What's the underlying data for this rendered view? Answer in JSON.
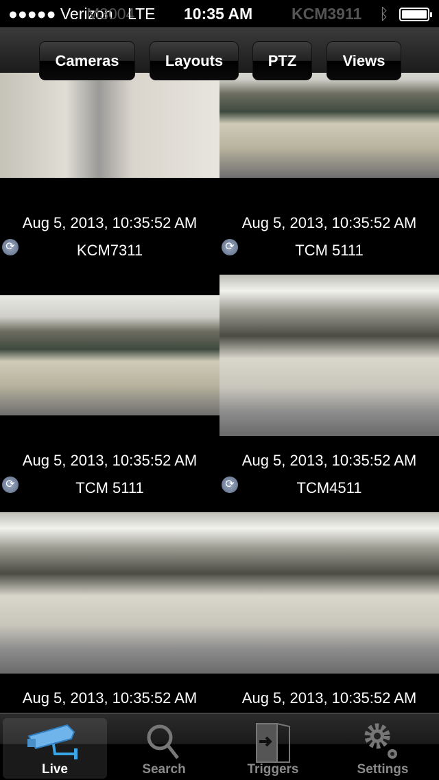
{
  "status_bar": {
    "carrier": "●●●●● Verizon",
    "network": "LTE",
    "ghost_text": "M3004",
    "time": "10:35 AM",
    "ghost_label": "KCM3911"
  },
  "toolbar": {
    "buttons": [
      "Cameras",
      "Layouts",
      "PTZ",
      "Views"
    ]
  },
  "cameras": [
    {
      "timestamp": "Aug 5, 2013, 10:35:52 AM",
      "name": "KCM7311"
    },
    {
      "timestamp": "Aug 5, 2013, 10:35:52 AM",
      "name": "TCM 5111"
    },
    {
      "timestamp": "Aug 5, 2013, 10:35:52 AM",
      "name": "TCM 5111"
    },
    {
      "timestamp": "Aug 5, 2013, 10:35:52 AM",
      "name": "TCM4511"
    },
    {
      "timestamp": "Aug 5, 2013, 10:35:52 AM"
    },
    {
      "timestamp": "Aug 5, 2013, 10:35:52 AM"
    }
  ],
  "tabbar": {
    "tabs": [
      {
        "label": "Live",
        "icon": "camera-icon",
        "active": true
      },
      {
        "label": "Search",
        "icon": "search-icon"
      },
      {
        "label": "Triggers",
        "icon": "door-icon"
      },
      {
        "label": "Settings",
        "icon": "gear-icon"
      }
    ],
    "accent": "#4aa8e8"
  }
}
